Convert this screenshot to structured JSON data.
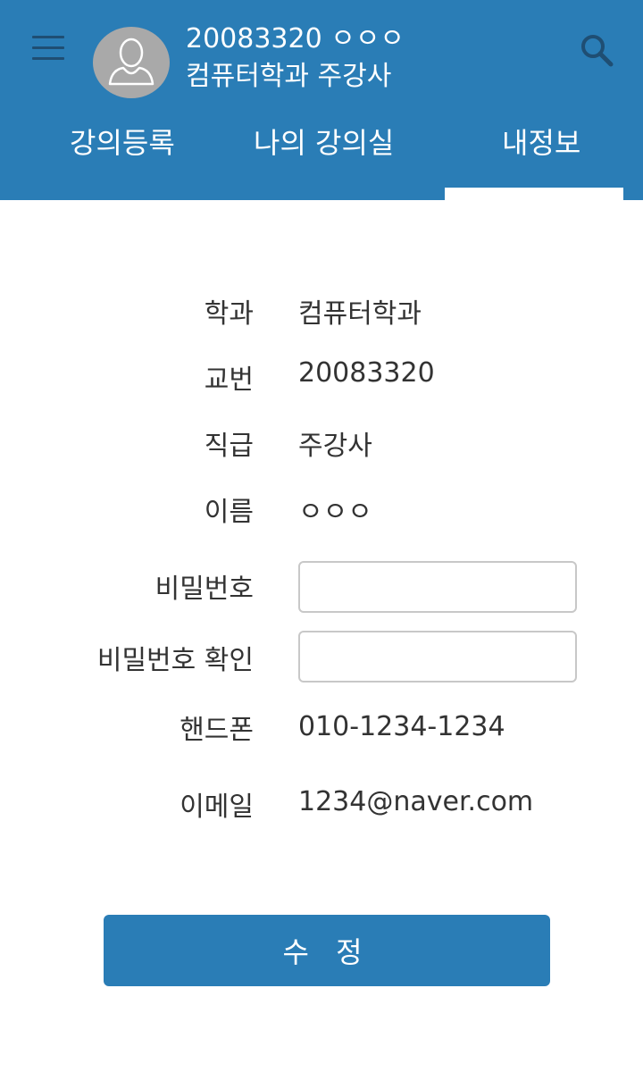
{
  "header": {
    "user_id_name": "20083320 ㅇㅇㅇ",
    "user_dept_title": "컴퓨터학과 주강사",
    "menu_icon": "hamburger-menu-icon",
    "search_icon": "search-icon",
    "avatar_icon": "user-silhouette-icon"
  },
  "tabs": [
    {
      "label": "강의등록",
      "active": false
    },
    {
      "label": "나의 강의실",
      "active": false
    },
    {
      "label": "내정보",
      "active": true
    }
  ],
  "form": {
    "department": {
      "label": "학과",
      "value": "컴퓨터학과"
    },
    "employee_no": {
      "label": "교번",
      "value": "20083320"
    },
    "position": {
      "label": "직급",
      "value": "주강사"
    },
    "name": {
      "label": "이름",
      "value": "ㅇㅇㅇ"
    },
    "password": {
      "label": "비밀번호",
      "value": "",
      "placeholder": ""
    },
    "password_confirm": {
      "label": "비밀번호 확인",
      "value": "",
      "placeholder": ""
    },
    "phone": {
      "label": "핸드폰",
      "value": "010-1234-1234"
    },
    "email": {
      "label": "이메일",
      "value": "1234@naver.com"
    }
  },
  "submit_label": "수 정",
  "colors": {
    "primary": "#2a7db6",
    "menu_icon": "#1f4e73",
    "avatar_bg": "#a9a9a9",
    "text": "#333333"
  }
}
